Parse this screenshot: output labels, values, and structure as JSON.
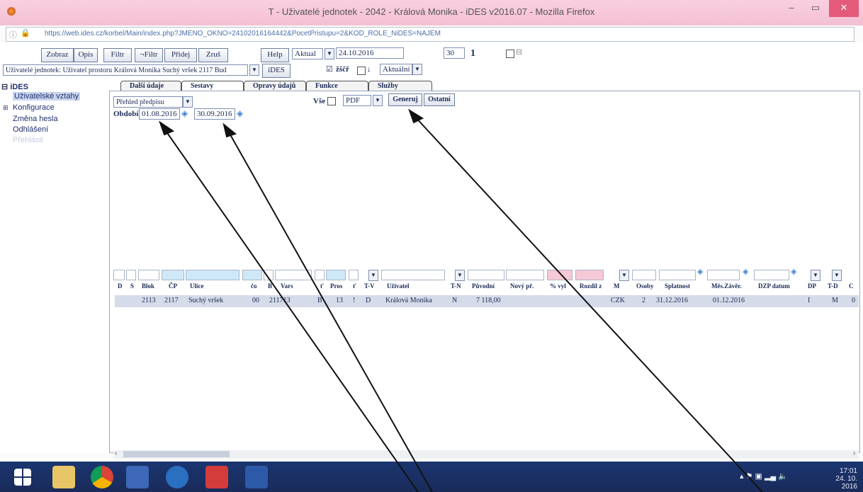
{
  "window": {
    "title": "T - Uživatelé jednotek - 2042 - Králová Monika - iDES v2016.07 - Mozilla Firefox",
    "url": "https://web.ides.cz/korbel/Main/index.php?JMENO_OKNO=24102016164442&PocetPristupu=2&KOD_ROLE_NiDES=NAJEM"
  },
  "toolbar": {
    "zobraz": "Zobraz",
    "opis": "Opis",
    "filtr": "Filtr",
    "not_filtr": "¬Filtr",
    "pridej": "Přidej",
    "zrus": "Zruš",
    "help": "Help",
    "aktual_select": "Aktual",
    "date": "24.10.2016",
    "count_box": "30",
    "count_value": "1",
    "context_select": "Uživatelé jednotek: Uživatel prostoru Králová Monika Suchý vršek 2117 Bud",
    "ides_button": "iDES",
    "zscr_label": "žščř",
    "down_label": "↓",
    "aktualni_select": "Aktuální"
  },
  "tree": {
    "root": "iDES",
    "items": [
      "Uživatelské vztahy",
      "Konfigurace",
      "Změna hesla",
      "Odhlášení",
      "Přehlásit"
    ]
  },
  "tabs": [
    "Další údaje",
    "Sestavy",
    "Opravy údajů",
    "Funkce",
    "Služby"
  ],
  "report": {
    "select": "Přehled předpisu",
    "obdobi_label": "Období:",
    "date_from": "01.08.2016",
    "date_to": "30.09.2016",
    "vse_label": "Vše",
    "format": "PDF",
    "generuj": "Generuj",
    "ostatni": "Ostatní"
  },
  "grid": {
    "headers": [
      "D",
      "S",
      "Blok",
      "ČP",
      "Ulice",
      "čo",
      "B",
      "Vars",
      "ť",
      "Pros",
      "ť",
      "T-V",
      "Uživatel",
      "T-N",
      "Původní",
      "Nový př.",
      "% vyl",
      "Rozdíl z",
      "M",
      "Osoby",
      "Splatnost",
      "Měs.Závěr.",
      "DZP datum",
      "DP",
      "T-D",
      "C"
    ],
    "row": [
      "2113",
      "2117",
      "Suchý vršek",
      "00",
      "211713",
      "B",
      "13",
      "!",
      "D",
      "Králová Monika",
      "N",
      "7 118,00",
      "CZK",
      "2",
      "31.12.2016",
      "01.12.2016",
      "I",
      "M",
      "0"
    ]
  },
  "taskbar": {
    "time": "17:01",
    "date": "24. 10. 2016"
  }
}
